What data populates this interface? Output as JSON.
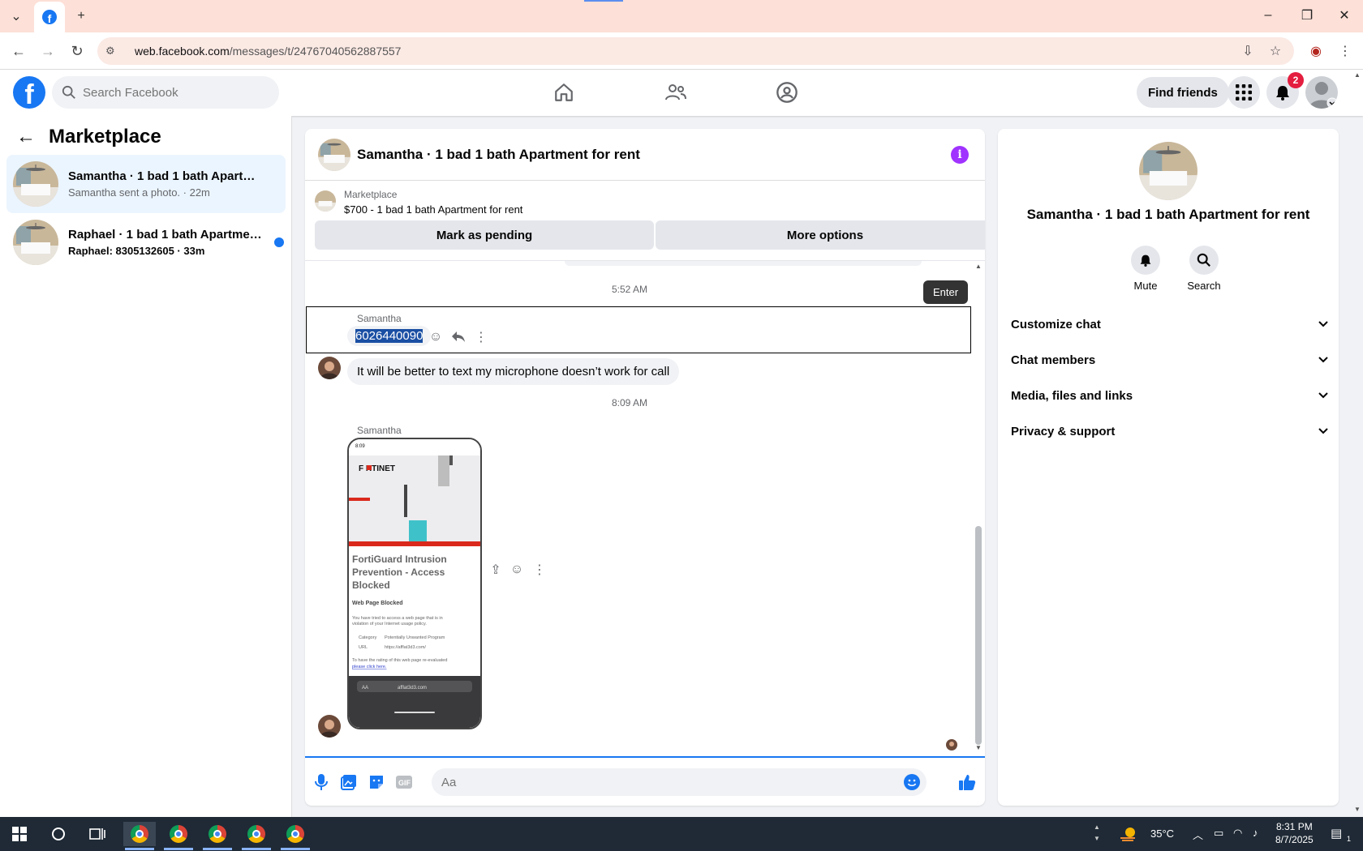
{
  "browser": {
    "tab_icon": "facebook-icon",
    "new_tab": "+",
    "url_domain": "web.facebook.com",
    "url_path": "/messages/t/24767040562887557"
  },
  "header": {
    "search_placeholder": "Search Facebook",
    "find_friends": "Find friends",
    "notification_count": "2"
  },
  "sidebar": {
    "title": "Marketplace",
    "chats": [
      {
        "name": "Samantha · 1 bad 1 bath Apartmen...",
        "subtitle": "Samantha sent a photo. · 22m",
        "active": true,
        "unread": false
      },
      {
        "name": "Raphael · 1 bad 1 bath Apartmen...",
        "subtitle": "Raphael: 8305132605 · 33m",
        "active": false,
        "unread": true
      }
    ]
  },
  "conversation": {
    "title": "Samantha · 1 bad 1 bath Apartment for rent",
    "marketplace_label": "Marketplace",
    "listing": "$700 - 1 bad 1 bath Apartment for rent",
    "mark_pending": "Mark as pending",
    "more_options": "More options",
    "tooltip": "Enter",
    "messages": [
      {
        "time": "5:52 AM"
      },
      {
        "sender": "Samantha",
        "text": "6026440090"
      },
      {
        "text": "It will be better to text my microphone doesn’t work for call"
      },
      {
        "time": "8:09 AM"
      },
      {
        "sender": "Samantha",
        "photo": true
      }
    ],
    "photo": {
      "status_time": "8:09",
      "brand": "F RTINET",
      "heading": "FortiGuard Intrusion Prevention - Access Blocked",
      "subheading": "Web Page Blocked",
      "body": "You have tried to access a web page that is in violation of your Internet usage policy.",
      "category_label": "Category",
      "category_value": "Potentially Unwanted Program",
      "url_label": "URL",
      "url_value": "https://afflat3d3.com/",
      "re_eval": "To have the rating of this web page re-evaluated",
      "link": "please click here.",
      "address_aa": "AA",
      "address": "afflat3d3.com"
    },
    "composer_placeholder": "Aa"
  },
  "details": {
    "name": "Samantha · 1 bad 1 bath Apartment for rent",
    "mute": "Mute",
    "search": "Search",
    "sections": [
      "Customize chat",
      "Chat members",
      "Media, files and links",
      "Privacy & support"
    ]
  },
  "taskbar": {
    "temperature": "35°C",
    "time": "8:31 PM",
    "date": "8/7/2025",
    "notif_count": "1"
  },
  "colors": {
    "fb_blue": "#1877f2",
    "info_purple": "#a033ff",
    "badge_red": "#e41e3f",
    "tab_strip": "#fde0d7"
  }
}
